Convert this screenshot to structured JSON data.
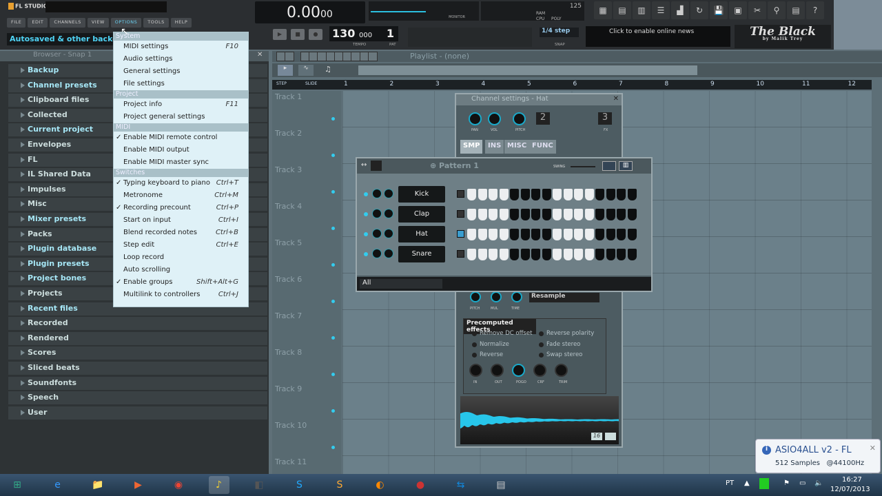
{
  "app": {
    "logo": "FL STUDIO",
    "hint": "Autosaved & other backed up"
  },
  "menubar": [
    "FILE",
    "EDIT",
    "CHANNELS",
    "VIEW",
    "OPTIONS",
    "TOOLS",
    "HELP"
  ],
  "active_menu": "OPTIONS",
  "transport": {
    "time": "0.00",
    "time_small": "00",
    "tempo": "130",
    "tempo_frac": "000",
    "pattern": "1",
    "tempo_label": "TEMPO",
    "pat_label": "PAT",
    "monitor_label": "MONITOR",
    "ram_label": "RAM",
    "cpu_label": "CPU",
    "poly_label": "POLY",
    "ram_value": "125",
    "snap": "1/4 step",
    "snap_label": "SNAP"
  },
  "toolbar_icons": [
    "playlist-icon",
    "step-seq-icon",
    "piano-roll-icon",
    "browser-icon",
    "mixer-icon",
    "undo-icon",
    "save-new-icon",
    "save-icon",
    "cut-icon",
    "record-mic-icon",
    "info-icon",
    "help-icon"
  ],
  "news": "Click to enable online news",
  "brand": {
    "title": "The Black",
    "subtitle": "by Malik Trey"
  },
  "browser": {
    "title": "Browser - Snap 1",
    "items": [
      {
        "label": "Backup",
        "hi": true
      },
      {
        "label": "Channel presets",
        "hi": true
      },
      {
        "label": "Clipboard files",
        "hi": false
      },
      {
        "label": "Collected",
        "hi": false
      },
      {
        "label": "Current project",
        "hi": true
      },
      {
        "label": "Envelopes",
        "hi": false
      },
      {
        "label": "FL",
        "hi": false
      },
      {
        "label": "IL Shared Data",
        "hi": false
      },
      {
        "label": "Impulses",
        "hi": false
      },
      {
        "label": "Misc",
        "hi": false
      },
      {
        "label": "Mixer presets",
        "hi": true
      },
      {
        "label": "Packs",
        "hi": false
      },
      {
        "label": "Plugin database",
        "hi": true
      },
      {
        "label": "Plugin presets",
        "hi": true
      },
      {
        "label": "Project bones",
        "hi": true
      },
      {
        "label": "Projects",
        "hi": false
      },
      {
        "label": "Recent files",
        "hi": true
      },
      {
        "label": "Recorded",
        "hi": false
      },
      {
        "label": "Rendered",
        "hi": false
      },
      {
        "label": "Scores",
        "hi": false
      },
      {
        "label": "Sliced beats",
        "hi": false
      },
      {
        "label": "Soundfonts",
        "hi": false
      },
      {
        "label": "Speech",
        "hi": false
      },
      {
        "label": "User",
        "hi": false
      }
    ]
  },
  "options_menu": [
    {
      "section": "System",
      "items": [
        {
          "label": "MIDI settings",
          "shortcut": "F10"
        },
        {
          "label": "Audio settings"
        },
        {
          "label": "General settings"
        },
        {
          "label": "File settings"
        }
      ]
    },
    {
      "section": "Project",
      "items": [
        {
          "label": "Project info",
          "shortcut": "F11"
        },
        {
          "label": "Project general settings"
        }
      ]
    },
    {
      "section": "MIDI",
      "items": [
        {
          "label": "Enable MIDI remote control",
          "checked": true
        },
        {
          "label": "Enable MIDI output"
        },
        {
          "label": "Enable MIDI master sync"
        }
      ]
    },
    {
      "section": "Switches",
      "items": [
        {
          "label": "Typing keyboard to piano",
          "shortcut": "Ctrl+T",
          "checked": true
        },
        {
          "label": "Metronome",
          "shortcut": "Ctrl+M"
        },
        {
          "label": "Recording precount",
          "shortcut": "Ctrl+P",
          "checked": true
        },
        {
          "label": "Start on input",
          "shortcut": "Ctrl+I"
        },
        {
          "label": "Blend recorded notes",
          "shortcut": "Ctrl+B"
        },
        {
          "label": "Step edit",
          "shortcut": "Ctrl+E"
        },
        {
          "label": "Loop record"
        },
        {
          "label": "Auto scrolling"
        },
        {
          "label": "Enable groups",
          "shortcut": "Shift+Alt+G",
          "checked": true
        },
        {
          "label": "Multilink to controllers",
          "shortcut": "Ctrl+J"
        }
      ]
    }
  ],
  "playlist": {
    "title": "Playlist - (none)",
    "step_label": "STEP",
    "slide_label": "SLIDE",
    "ruler": [
      "1",
      "2",
      "3",
      "4",
      "5",
      "6",
      "7",
      "8",
      "9",
      "10",
      "11",
      "12"
    ],
    "tracks": [
      "Track 1",
      "Track 2",
      "Track 3",
      "Track 4",
      "Track 5",
      "Track 6",
      "Track 7",
      "Track 8",
      "Track 9",
      "Track 10",
      "Track 11"
    ]
  },
  "channel_settings": {
    "title": "Channel settings - Hat",
    "knobs": [
      "PAN",
      "VOL",
      "PITCH"
    ],
    "channel_num": "2",
    "fx_num": "3",
    "fx_label": "FX",
    "tabs": [
      "SMP",
      "INS",
      "MISC",
      "FUNC"
    ],
    "active_tab": "SMP",
    "mid_knobs": [
      "PITCH",
      "MUL",
      "TIME"
    ],
    "resample": "Resample",
    "precomputed_title": "Precomputed effects",
    "options": [
      "Remove DC offset",
      "Normalize",
      "Reverse",
      "Reverse polarity",
      "Fade stereo",
      "Swap stereo"
    ],
    "fx_knobs": [
      "IN",
      "OUT",
      "POGO",
      "CRF",
      "TRIM"
    ],
    "wave_badge": "16",
    "wave_color": "#27c6ea"
  },
  "step_sequencer": {
    "title": "Pattern 1",
    "swing_label": "SWING",
    "filter": "All",
    "channels": [
      {
        "name": "Kick",
        "selected": false,
        "steps": [
          0,
          0,
          0,
          0,
          0,
          0,
          0,
          0,
          0,
          0,
          0,
          0,
          0,
          0,
          0,
          0
        ]
      },
      {
        "name": "Clap",
        "selected": false,
        "steps": [
          0,
          0,
          0,
          0,
          0,
          0,
          0,
          0,
          0,
          0,
          0,
          0,
          0,
          0,
          0,
          0
        ]
      },
      {
        "name": "Hat",
        "selected": true,
        "steps": [
          0,
          0,
          0,
          0,
          0,
          0,
          0,
          0,
          0,
          0,
          0,
          0,
          0,
          0,
          0,
          0
        ]
      },
      {
        "name": "Snare",
        "selected": false,
        "steps": [
          0,
          0,
          0,
          0,
          0,
          0,
          0,
          0,
          0,
          0,
          0,
          0,
          0,
          0,
          0,
          0
        ]
      }
    ]
  },
  "notification": {
    "title": "ASIO4ALL v2 - FL",
    "body": "512 Samples   @44100Hz"
  },
  "taskbar": {
    "apps": [
      "start-icon",
      "internet-explorer-icon",
      "file-explorer-icon",
      "media-player-icon",
      "chrome-icon",
      "fl-studio-icon",
      "game-icon",
      "skype-icon",
      "app-icon",
      "vlc-icon",
      "mouse-icon",
      "teamviewer-icon",
      "notepad-icon"
    ],
    "lang": "PT",
    "time": "16:27",
    "date": "12/07/2013"
  }
}
